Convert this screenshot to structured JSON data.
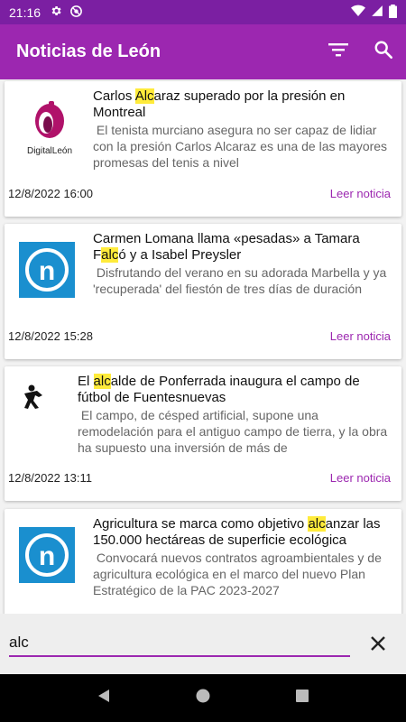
{
  "status_bar": {
    "time": "21:16",
    "left_icons": [
      "gear-icon",
      "data-saver-icon"
    ],
    "right_icons": [
      "wifi-icon",
      "signal-icon",
      "battery-icon"
    ]
  },
  "app_bar": {
    "title": "Noticias de León",
    "actions": [
      "filter-icon",
      "search-icon"
    ],
    "color": "#9c27b0"
  },
  "search": {
    "query": "alc",
    "highlight_color": "#ffeb3b"
  },
  "news": [
    {
      "source": "DigitalLeón",
      "title_parts": [
        "Carlos ",
        "Alc",
        "araz superado por la presión en Montreal"
      ],
      "description": "El tenista murciano asegura no ser capaz de lidiar con la presión Carlos Alcaraz es una de las mayores promesas del tenis a nivel",
      "date": "12/8/2022 16:00",
      "action": "Leer noticia"
    },
    {
      "source": "n",
      "title_parts": [
        "Carmen Lomana llama «pesadas» a Tamara F",
        "alc",
        "ó y a Isabel Preysler"
      ],
      "description": "Disfrutando del verano en su adorada Marbella y ya 'recuperada' del fiestón de tres días de duración",
      "date": "12/8/2022 15:28",
      "action": "Leer noticia"
    },
    {
      "source": "",
      "title_parts": [
        "El ",
        "alc",
        "alde de Ponferrada inaugura el campo de fútbol de Fuentesnuevas"
      ],
      "description": "El campo, de césped artificial, supone una remodelación para el antiguo campo de tierra, y la obra ha supuesto una inversión de más de",
      "date": "12/8/2022 13:11",
      "action": "Leer noticia"
    },
    {
      "source": "n",
      "title_parts": [
        "Agricultura se marca como objetivo ",
        "alc",
        "anzar las 150.000 hectáreas de superficie ecológica"
      ],
      "description": "Convocará nuevos contratos agroambientales y de agricultura ecológica en el marco del nuevo Plan Estratégico de la PAC 2023-2027",
      "date": "",
      "action": ""
    }
  ],
  "nav_bar": [
    "back-icon",
    "home-icon",
    "recents-icon"
  ]
}
